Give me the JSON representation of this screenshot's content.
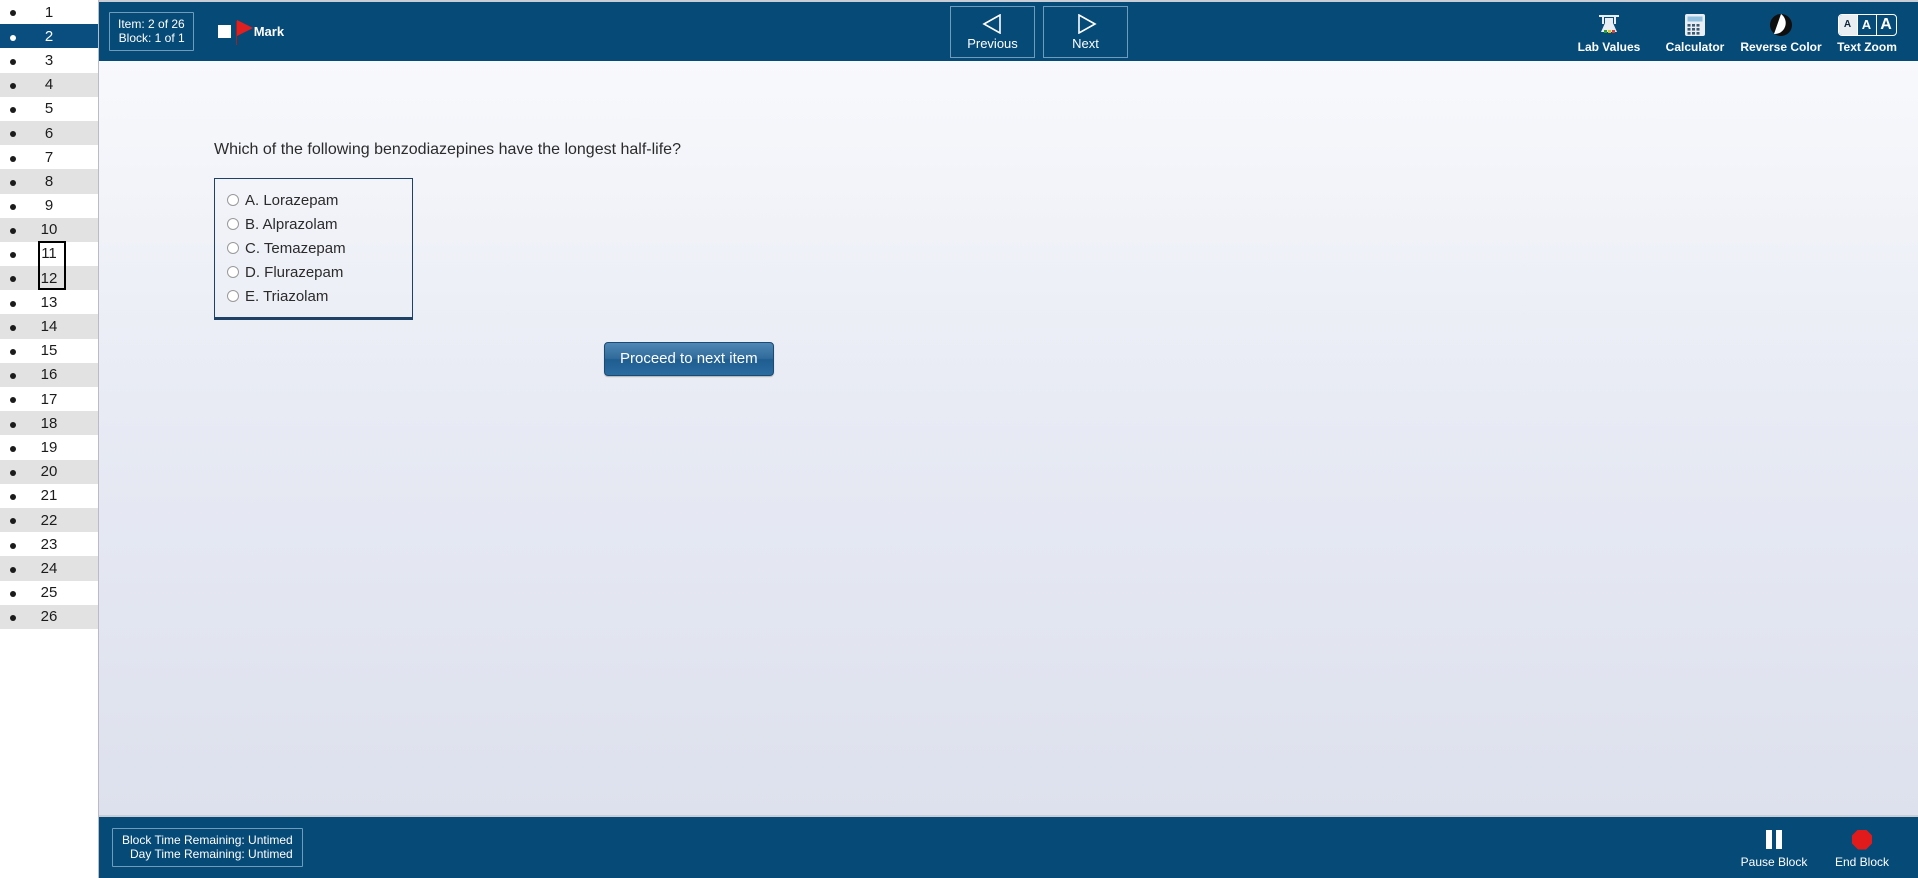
{
  "sidebar": {
    "items": [
      {
        "number": "1"
      },
      {
        "number": "2"
      },
      {
        "number": "3"
      },
      {
        "number": "4"
      },
      {
        "number": "5"
      },
      {
        "number": "6"
      },
      {
        "number": "7"
      },
      {
        "number": "8"
      },
      {
        "number": "9"
      },
      {
        "number": "10"
      },
      {
        "number": "11"
      },
      {
        "number": "12"
      },
      {
        "number": "13"
      },
      {
        "number": "14"
      },
      {
        "number": "15"
      },
      {
        "number": "16"
      },
      {
        "number": "17"
      },
      {
        "number": "18"
      },
      {
        "number": "19"
      },
      {
        "number": "20"
      },
      {
        "number": "21"
      },
      {
        "number": "22"
      },
      {
        "number": "23"
      },
      {
        "number": "24"
      },
      {
        "number": "25"
      },
      {
        "number": "26"
      }
    ],
    "selected_index": 1,
    "bullet_glyph": "●"
  },
  "header": {
    "item_line": "Item: 2 of 26",
    "block_line": "Block: 1 of 1",
    "mark_label": "Mark",
    "mark_checked": false,
    "previous_label": "Previous",
    "next_label": "Next",
    "tools": [
      {
        "label": "Lab Values",
        "icon": "lab-values-icon"
      },
      {
        "label": "Calculator",
        "icon": "calculator-icon"
      },
      {
        "label": "Reverse Color",
        "icon": "reverse-color-icon"
      },
      {
        "label": "Text Zoom",
        "icon": "text-zoom-icon"
      }
    ],
    "text_zoom": {
      "sizes": [
        "A",
        "A",
        "A"
      ],
      "active_index": 0
    }
  },
  "question": {
    "stem": "Which of the following benzodiazepines have the longest half-life?",
    "options": [
      {
        "letter": "A.",
        "text": "Lorazepam",
        "label": "A. Lorazepam",
        "selected": false
      },
      {
        "letter": "B.",
        "text": "Alprazolam",
        "label": "B. Alprazolam",
        "selected": false
      },
      {
        "letter": "C.",
        "text": "Temazepam",
        "label": "C. Temazepam",
        "selected": false
      },
      {
        "letter": "D.",
        "text": "Flurazepam",
        "label": "D. Flurazepam",
        "selected": false
      },
      {
        "letter": "E.",
        "text": "Triazolam",
        "label": "E. Triazolam",
        "selected": false
      }
    ],
    "proceed_label": "Proceed to next item"
  },
  "footer": {
    "block_time": "Block Time Remaining: Untimed",
    "day_time": "Day Time Remaining: Untimed",
    "pause_label": "Pause Block",
    "end_label": "End Block"
  },
  "colors": {
    "header_blue": "#064a77",
    "selected_row": "#0a4e7f",
    "flag_red": "#e02020",
    "stop_red": "#e11b1b",
    "option_border": "#1d4266"
  }
}
